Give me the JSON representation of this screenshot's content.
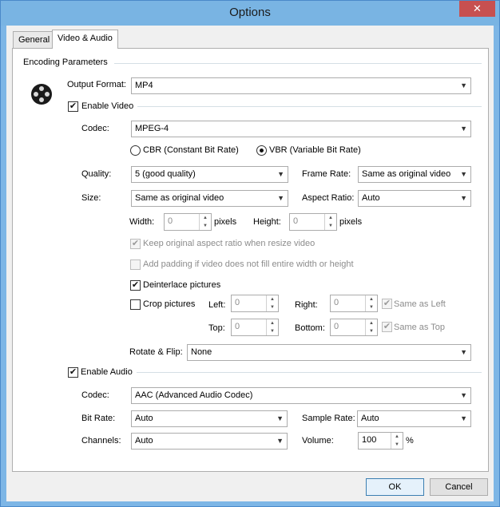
{
  "window": {
    "title": "Options",
    "close_glyph": "✕"
  },
  "tabs": [
    {
      "label": "General",
      "active": false
    },
    {
      "label": "Video & Audio",
      "active": true
    }
  ],
  "encoding": {
    "group_label": "Encoding Parameters",
    "icon": "film-reel-icon",
    "output_format_label": "Output Format:",
    "output_format_value": "MP4"
  },
  "video": {
    "enable_label": "Enable Video",
    "enabled": true,
    "codec_label": "Codec:",
    "codec_value": "MPEG-4",
    "cbr_label": "CBR (Constant Bit Rate)",
    "vbr_label": "VBR (Variable Bit Rate)",
    "rate_mode": "VBR",
    "quality_label": "Quality:",
    "quality_value": "5 (good quality)",
    "frame_rate_label": "Frame Rate:",
    "frame_rate_value": "Same as original video",
    "size_label": "Size:",
    "size_value": "Same as original video",
    "aspect_label": "Aspect Ratio:",
    "aspect_value": "Auto",
    "width_label": "Width:",
    "width_value": "0",
    "width_unit": "pixels",
    "height_label": "Height:",
    "height_value": "0",
    "height_unit": "pixels",
    "keep_aspect_label": "Keep original aspect ratio when resize video",
    "keep_aspect_checked": true,
    "padding_label": "Add padding if video does not fill entire width or height",
    "padding_checked": false,
    "deinterlace_label": "Deinterlace pictures",
    "deinterlace_checked": true,
    "crop_label": "Crop pictures",
    "crop_checked": false,
    "left_label": "Left:",
    "left_value": "0",
    "right_label": "Right:",
    "right_value": "0",
    "same_as_left_label": "Same as Left",
    "top_label": "Top:",
    "top_value": "0",
    "bottom_label": "Bottom:",
    "bottom_value": "0",
    "same_as_top_label": "Same as Top",
    "rotate_label": "Rotate & Flip:",
    "rotate_value": "None"
  },
  "audio": {
    "enable_label": "Enable Audio",
    "enabled": true,
    "codec_label": "Codec:",
    "codec_value": "AAC (Advanced Audio Codec)",
    "bitrate_label": "Bit Rate:",
    "bitrate_value": "Auto",
    "samplerate_label": "Sample Rate:",
    "samplerate_value": "Auto",
    "channels_label": "Channels:",
    "channels_value": "Auto",
    "volume_label": "Volume:",
    "volume_value": "100",
    "volume_unit": "%"
  },
  "footer": {
    "ok_label": "OK",
    "cancel_label": "Cancel"
  },
  "colors": {
    "titlebar": "#79b4e3",
    "close": "#c75050",
    "default_button_border": "#3c7fb1"
  }
}
